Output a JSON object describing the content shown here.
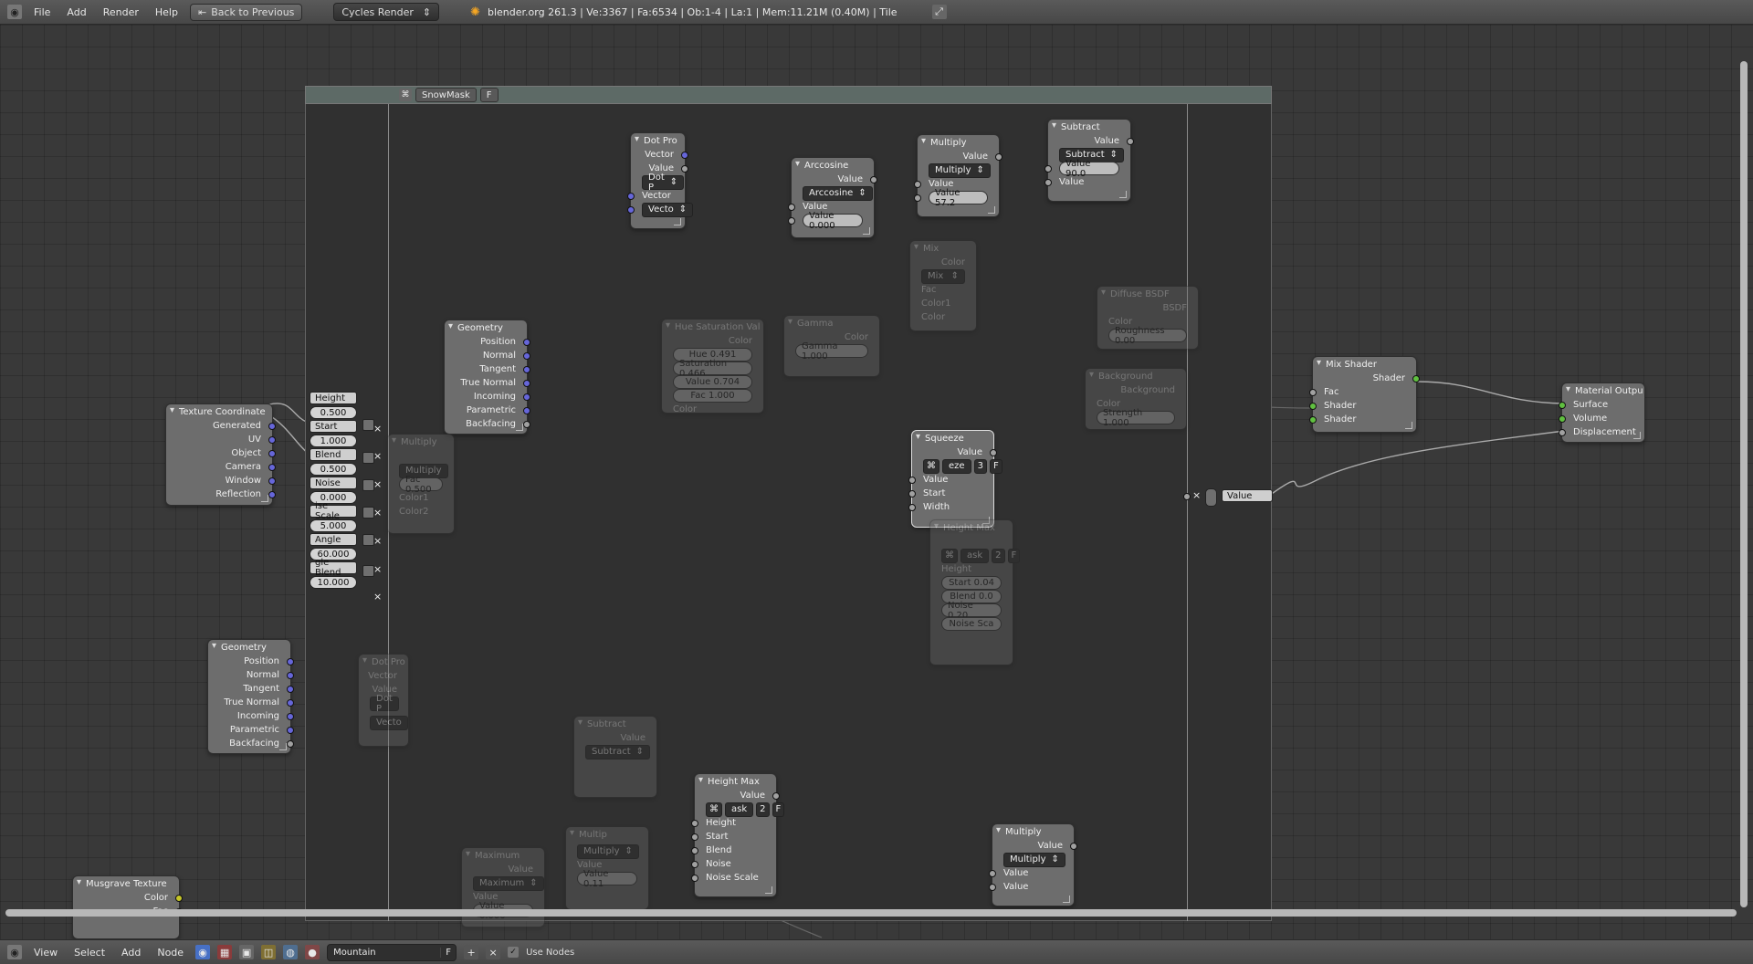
{
  "topbar": {
    "menus": [
      "File",
      "Add",
      "Render",
      "Help"
    ],
    "back_label": "Back to Previous",
    "render_engine": "Cycles Render",
    "info": "blender.org 261.3 | Ve:3367 | Fa:6534 | Ob:1-4 | La:1 | Mem:11.21M (0.40M) | Tile"
  },
  "bottombar": {
    "menus": [
      "View",
      "Select",
      "Add",
      "Node"
    ],
    "material_name": "Mountain",
    "material_flag": "F",
    "use_nodes_label": "Use Nodes"
  },
  "group": {
    "title": "SnowMask",
    "flag": "F"
  },
  "nodes": {
    "texture_coordinate": {
      "title": "Texture Coordinate",
      "outputs": [
        "Generated",
        "UV",
        "Object",
        "Camera",
        "Window",
        "Reflection"
      ]
    },
    "geometry_outer": {
      "title": "Geometry",
      "outputs": [
        "Position",
        "Normal",
        "Tangent",
        "True Normal",
        "Incoming",
        "Parametric",
        "Backfacing"
      ]
    },
    "musgrave": {
      "title": "Musgrave Texture",
      "outputs": [
        "Color",
        "Fac"
      ]
    },
    "group_inputs": [
      {
        "label": "Height",
        "value": "0.500"
      },
      {
        "label": "Start",
        "value": "1.000"
      },
      {
        "label": "Blend",
        "value": "0.500"
      },
      {
        "label": "Noise",
        "value": "0.000"
      },
      {
        "label": "ise Scale",
        "value": "5.000"
      },
      {
        "label": "Angle",
        "value": "60.000"
      },
      {
        "label": "gle Blend",
        "value": "10.000"
      }
    ],
    "geometry_inner": {
      "title": "Geometry",
      "outputs": [
        "Position",
        "Normal",
        "Tangent",
        "True Normal",
        "Incoming",
        "Parametric",
        "Backfacing"
      ]
    },
    "dot_product": {
      "title": "Dot Pro",
      "out_vector": "Vector",
      "out_value": "Value",
      "op": "Dot P",
      "in_vector": "Vector",
      "in_vector_field": "Vecto"
    },
    "arccosine": {
      "title": "Arccosine",
      "out_value": "Value",
      "op": "Arccosine",
      "in_value": "Value",
      "field": "Value 0.000"
    },
    "multiply_top": {
      "title": "Multiply",
      "out_value": "Value",
      "op": "Multiply",
      "in_value": "Value",
      "field": "Value 57.2"
    },
    "subtract_top": {
      "title": "Subtract",
      "out_value": "Value",
      "op": "Subtract",
      "field": "Value 90.0",
      "in_value": "Value"
    },
    "squeeze": {
      "title": "Squeeze",
      "out_value": "Value",
      "group_field": "eze",
      "group_users": "3",
      "group_flag": "F",
      "inputs": [
        "Value",
        "Start",
        "Width"
      ]
    },
    "height_max": {
      "title": "Height Max",
      "out_value": "Value",
      "group_field": "ask",
      "group_users": "2",
      "group_flag": "F",
      "inputs": [
        "Height",
        "Start",
        "Blend",
        "Noise",
        "Noise Scale"
      ]
    },
    "multiply_bottom": {
      "title": "Multiply",
      "out_value": "Value",
      "op": "Multiply",
      "inputs": [
        "Value",
        "Value"
      ]
    },
    "mix_shader": {
      "title": "Mix Shader",
      "out": "Shader",
      "inputs": [
        "Fac",
        "Shader",
        "Shader"
      ]
    },
    "material_output": {
      "title": "Material Outpu",
      "inputs": [
        "Surface",
        "Volume",
        "Displacement"
      ]
    },
    "group_output": {
      "label": "Value"
    },
    "dim_hue": {
      "title": "Hue Saturation Val",
      "out": "Color",
      "fields": [
        "Hue 0.491",
        "Saturation 0.466",
        "Value 0.704",
        "Fac 1.000"
      ],
      "in": "Color"
    },
    "dim_gamma": {
      "title": "Gamma",
      "out": "Color",
      "field": "Gamma 1.000"
    },
    "dim_mix": {
      "title": "Mix",
      "out": "Color",
      "op": "Mix",
      "inputs": [
        "Fac",
        "Color1",
        "Color"
      ]
    },
    "dim_diffuse": {
      "title": "Diffuse BSDF",
      "out": "BSDF",
      "in": "Color",
      "field": "Roughness 0.00"
    },
    "dim_background": {
      "title": "Background",
      "out": "Background",
      "in": "Color",
      "field": "Strength 1.000"
    },
    "dim_height_max": {
      "title": "Height Max",
      "group_field": "ask",
      "group_users": "2",
      "group_flag": "F",
      "in_height": "Height",
      "fields": [
        "Start 0.04",
        "Blend 0.0",
        "Noise 0.20",
        "Noise Sca"
      ]
    },
    "dim_dot": {
      "title": "Dot Pro",
      "outputs": [
        "Vector",
        "Value"
      ],
      "op": "Dot P",
      "in": "Vecto"
    },
    "dim_subtract": {
      "title": "Subtract",
      "out": "Value",
      "op": "Subtract"
    },
    "dim_maximum": {
      "title": "Maximum",
      "out": "Value",
      "op": "Maximum",
      "in": "Value",
      "field": "Value 0.000"
    },
    "dim_multiply_low": {
      "title": "Multip",
      "op": "Multiply",
      "in": "Value",
      "field": "Value 0.11"
    },
    "dim_multiply_left": {
      "title": "Multiply",
      "op": "Multiply",
      "field": "Fac 0.500",
      "in": "Color1",
      "in2": "Color2"
    }
  }
}
